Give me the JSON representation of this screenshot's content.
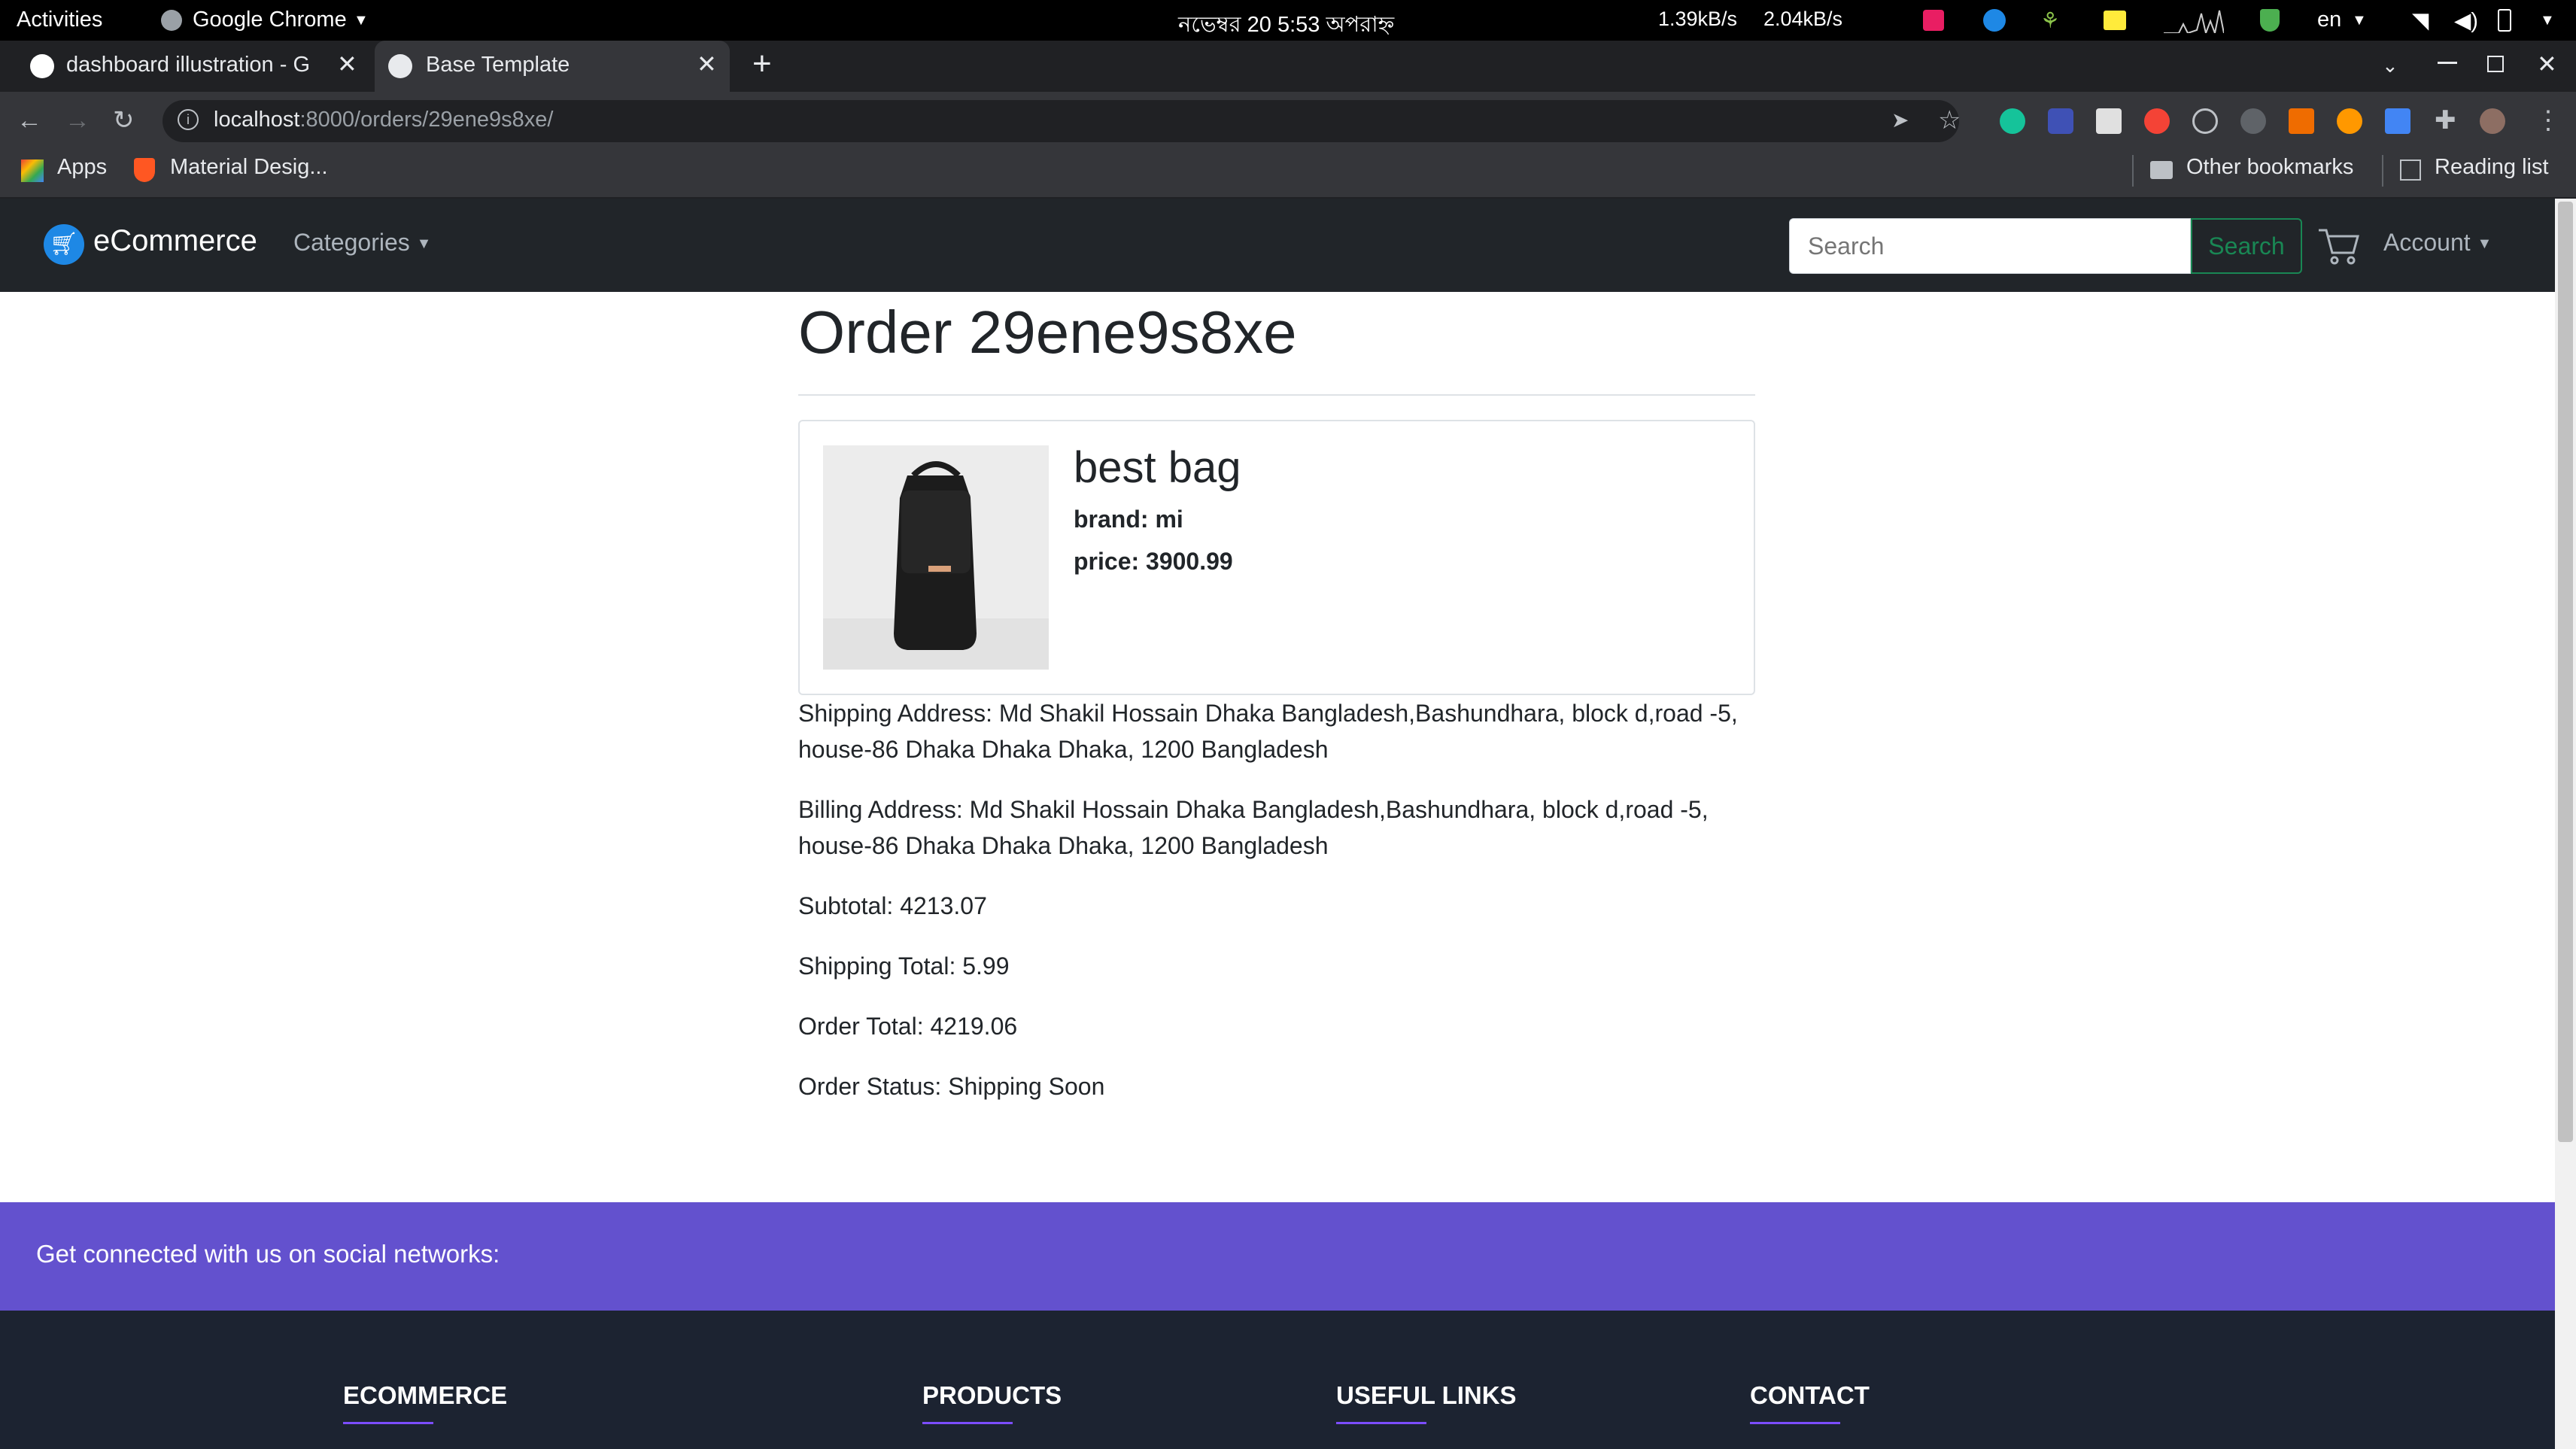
{
  "system_bar": {
    "activities": "Activities",
    "app_menu": "Google Chrome",
    "clock": "নভেম্বর 20   5:53 অপরাহ্ন",
    "net_down": "1.39kB/s",
    "net_up": "2.04kB/s",
    "language": "en"
  },
  "browser": {
    "tabs": [
      {
        "title": "dashboard illustration - G",
        "active": false
      },
      {
        "title": "Base Template",
        "active": true
      }
    ],
    "url_host": "localhost",
    "url_path": ":8000/orders/29ene9s8xe/",
    "bookmarks": {
      "apps": "Apps",
      "material": "Material Desig...",
      "other": "Other bookmarks",
      "reading": "Reading list"
    }
  },
  "navbar": {
    "brand": "eCommerce",
    "categories": "Categories",
    "search_placeholder": "Search",
    "search_button": "Search",
    "account": "Account"
  },
  "order": {
    "title": "Order 29ene9s8xe",
    "product": {
      "name": "best bag",
      "brand": "brand: mi",
      "price": "price: 3900.99"
    },
    "shipping_address": "Shipping Address: Md Shakil Hossain Dhaka Bangladesh,Bashundhara, block d,road -5, house-86 Dhaka Dhaka Dhaka, 1200 Bangladesh",
    "billing_address": "Billing Address: Md Shakil Hossain Dhaka Bangladesh,Bashundhara, block d,road -5, house-86 Dhaka Dhaka Dhaka, 1200 Bangladesh",
    "subtotal": "Subtotal: 4213.07",
    "shipping_total": "Shipping Total: 5.99",
    "order_total": "Order Total: 4219.06",
    "status": "Order Status: Shipping Soon"
  },
  "footer": {
    "social_text": "Get connected with us on social networks:",
    "headings": [
      "ECOMMERCE",
      "PRODUCTS",
      "USEFUL LINKS",
      "CONTACT"
    ]
  },
  "colors": {
    "navbar_bg": "#212529",
    "social_bar": "#6351ce",
    "footer_bg": "#1c2331",
    "search_green": "#198754"
  }
}
